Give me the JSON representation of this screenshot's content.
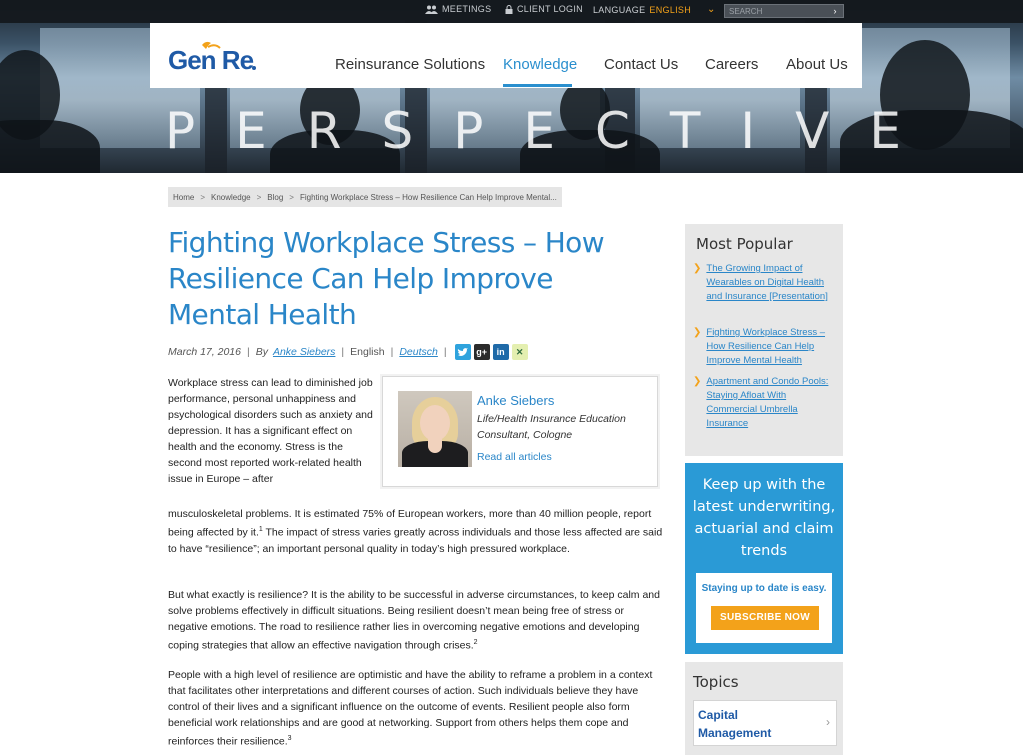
{
  "topbar": {
    "meetings": "MEETINGS",
    "client_login": "CLIENT LOGIN",
    "language_label": "LANGUAGE",
    "language_value": "ENGLISH",
    "search_placeholder": "SEARCH"
  },
  "brand": {
    "logo_text": "Gen Re"
  },
  "nav": [
    {
      "label": "Reinsurance Solutions"
    },
    {
      "label": "Knowledge",
      "active": true
    },
    {
      "label": "Contact Us"
    },
    {
      "label": "Careers"
    },
    {
      "label": "About Us"
    }
  ],
  "hero": {
    "banner_text": "PERSPECTIVE"
  },
  "breadcrumb": [
    "Home",
    "Knowledge",
    "Blog",
    "Fighting Workplace Stress – How Resilience Can Help Improve Mental..."
  ],
  "article": {
    "title": "Fighting Workplace Stress – How Resilience Can Help Improve Mental Health",
    "date": "March 17, 2016",
    "by": "By",
    "author_link": "Anke Siebers",
    "language": "English",
    "alt_language": "Deutsch",
    "share_icons": [
      "twitter-icon",
      "google-plus-icon",
      "linkedin-icon",
      "xing-icon"
    ],
    "p1a": "Workplace stress can lead to diminished job performance, personal unhappiness and psychological disorders such as anxiety and depression. It has a significant effect on health and the economy. Stress is the second most reported work-related health issue in Europe – after",
    "p1b": "musculoskeletal problems. It is estimated 75% of European workers, more than 40 million people, report being affected by it.",
    "p1b_sup": "1",
    "p1c": " The impact of stress varies greatly across individuals and those less affected are said to have “resilience”; an important personal quality in today’s high pressured workplace.",
    "p2": "But what exactly is resilience? It is the ability to be successful in adverse circumstances, to keep calm and solve problems effectively in difficult situations. Being resilient doesn’t mean being free of stress or negative emotions. The road to resilience rather lies in overcoming negative emotions and developing coping strategies that allow an effective navigation through crises.",
    "p2_sup": "2",
    "p3": "People with a high level of resilience are optimistic and have the ability to reframe a problem in a context that facilitates other interpretations and different courses of action. Such individuals believe they have control of their lives and a significant influence on the outcome of events. Resilient people also form beneficial work relationships and are good at networking. Support from others helps them cope and reinforces their resilience.",
    "p3_sup": "3"
  },
  "author_card": {
    "name": "Anke Siebers",
    "role": "Life/Health Insurance Education Consultant, Cologne",
    "read_all": "Read all articles"
  },
  "most_popular": {
    "title": "Most Popular",
    "items": [
      "The Growing Impact of Wearables on Digital Health and Insurance [Presentation]",
      "Fighting Workplace Stress – How Resilience Can Help Improve Mental Health",
      "Apartment and Condo Pools: Staying Afloat With Commercial Umbrella Insurance"
    ]
  },
  "subscribe": {
    "headline": "Keep up with the latest underwriting, actuarial and claim trends",
    "tagline": "Staying up to date is easy.",
    "button": "SUBSCRIBE NOW"
  },
  "topics": {
    "title": "Topics",
    "first_item": "Capital Management"
  },
  "colors": {
    "accent_blue": "#2a86c8",
    "brand_orange": "#f3a21a",
    "subscribe_bg": "#2a9ad6"
  }
}
